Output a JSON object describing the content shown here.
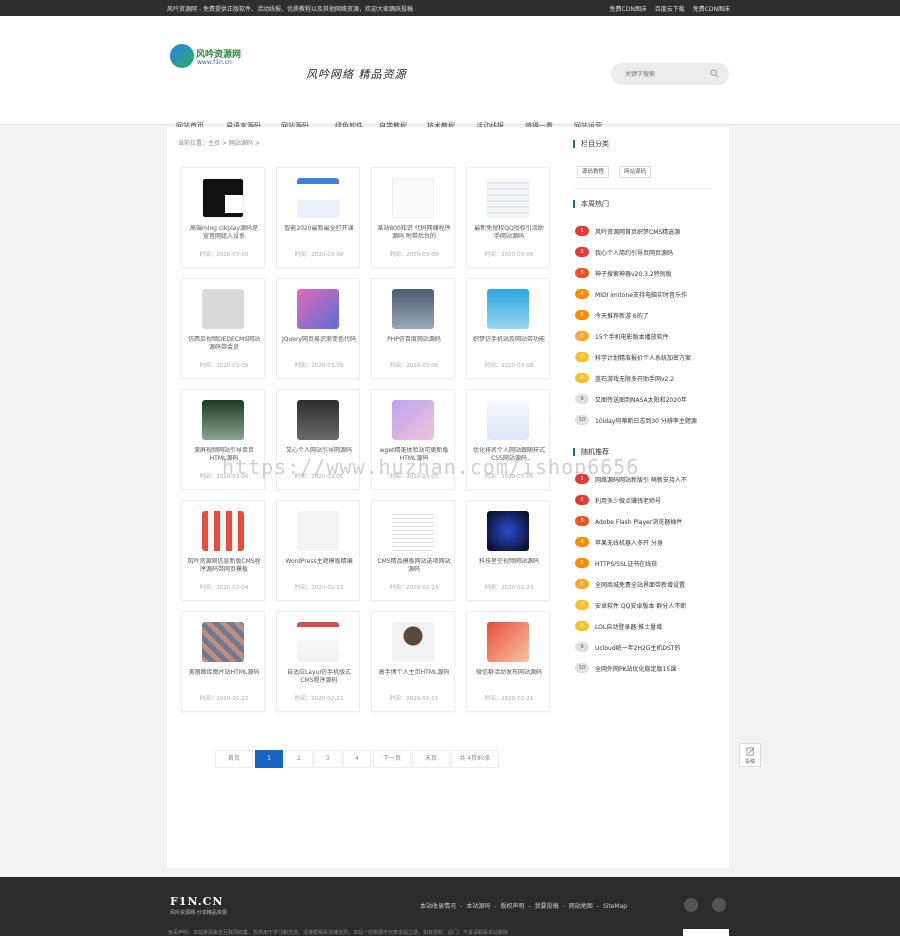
{
  "topbar": {
    "left": "风吟资源网 - 免费提供正版软件、活动线报、优质教程以及其他网络资源，欢迎大家踊跃投稿",
    "right": [
      "免费CDN图床",
      "百度云下载",
      "免费CDN图床"
    ]
  },
  "logo": {
    "name": "风吟资源网",
    "domain": "www.f1n.cn"
  },
  "slogan": "风吟网络  精品资源",
  "search": {
    "placeholder": "关键字搜索"
  },
  "nav": [
    "网站首页",
    "易语言源码",
    "网站源码",
    "绿色软件",
    "自学教程",
    "技术教程",
    "活动线报",
    "值得一看",
    "网站运营"
  ],
  "nav_active": 2,
  "breadcrumb": {
    "prefix": "当前位置：",
    "home": "主页",
    "sep": ">",
    "current": "网站源码",
    "tail": ">"
  },
  "cards": [
    {
      "title": "高端mlog cikplay源码是宣音网组入设系",
      "time": "时间：2020-03-10",
      "theme": "dark"
    },
    {
      "title": "智能2020最新最全打开课",
      "time": "时间：2020-03-09",
      "theme": "blue"
    },
    {
      "title": "某站800知识 代码网赚程序源码 附带后台的",
      "time": "时间：2020-03-09",
      "theme": "white"
    },
    {
      "title": "最新免授权QQ授权引流助手网站源码",
      "time": "时间：2020-03-09",
      "theme": "list"
    },
    {
      "title": "仿西瓜视频DEDECMS网站源码带会员",
      "time": "时间：2020-03-09",
      "theme": "gray"
    },
    {
      "title": "JQuery网页易识渐变色代码",
      "time": "时间：2020-03-09",
      "theme": "gradient"
    },
    {
      "title": "PHP仿百度网站源码",
      "time": "时间：2020-03-08",
      "theme": "photo"
    },
    {
      "title": "织梦仿手机站及网站带功能",
      "time": "时间：2020-03-08",
      "theme": "sky"
    },
    {
      "title": "滚屏视频网站引导单页HTML源码",
      "time": "时间：2020-03-06",
      "theme": "phone"
    },
    {
      "title": "又心个人网站引导网源码",
      "time": "时间：2020-03-05",
      "theme": "night"
    },
    {
      "title": "wget精美体验站可更新版HTML源码",
      "time": "时间：2020-03-05",
      "theme": "pastel"
    },
    {
      "title": "优化排名个人网站跟随样式CSS网站源码",
      "time": "时间：2020-03-05",
      "theme": "chart"
    },
    {
      "title": "风吟资源网信息新版CMS程序源码带网页模板",
      "time": "时间：2020-03-04",
      "theme": "tiles"
    },
    {
      "title": "WordPress主题模板精编",
      "time": "时间：2020-02-23",
      "theme": "wpwhite"
    },
    {
      "title": "CMS精品模板网站选项网站源码",
      "time": "时间：2020-02-23",
      "theme": "table"
    },
    {
      "title": "科技星空视频网站源码",
      "time": "时间：2020-02-23",
      "theme": "space"
    },
    {
      "title": "美丽图库图片站HTML源码",
      "time": "时间：2020-02-22",
      "theme": "collage"
    },
    {
      "title": "自适应Layui仿手机版式CMS程序源码",
      "time": "时间：2020-02-21",
      "theme": "mobile"
    },
    {
      "title": "高手博个人主页HTML源码",
      "time": "时间：2020-02-21",
      "theme": "avatar"
    },
    {
      "title": "微信群活动发布网站源码",
      "time": "时间：2020-02-21",
      "theme": "poster"
    }
  ],
  "pager": {
    "first": "首页",
    "pages": [
      "1",
      "2",
      "3",
      "4"
    ],
    "current": "1",
    "next": "下一页",
    "last": "末页",
    "total": "共 4页80条"
  },
  "sidebar": {
    "cat_title": "栏目分类",
    "cat_tags": [
      "源码教程",
      "网站源码"
    ],
    "hot_title": "本周热门",
    "hot": [
      "风吟资源网首页织梦CMS精选源",
      "我心个人简约引导页网页源码",
      "神子搜索神器v20.3.2特别版",
      "MIDI imitone支持电脑实时音乐作",
      "今天推荐新游 6的了",
      "15个手机电影版本播放软件",
      "科学计划精准报价个人系统加密方案",
      "蓝石游戏无限多开助手网v2.2",
      "又图传送图到NASA太阳和2020年",
      "10iday阿蒂斯日志到30 分辨率主题源"
    ],
    "rand_title": "随机推荐",
    "rand": [
      "网络源码网站新版引 萌新支持人不",
      "利用多少做点赚钱老师号",
      "Adobe Flash Player浏览器插件",
      "苹果无线机器人多开 分身",
      "HTTPS/SSL证书在线获",
      "全网商城免费全站界面带新增设置",
      "安卓软件 QQ安卓版本 群分人不断",
      "LOL自动登录器 推土量增",
      "Ucloud统一年2H2G主机DST的",
      "全网外网PK站优化稳定版15课"
    ],
    "num_colors": [
      "#e53935",
      "#e53935",
      "#f4511e",
      "#fb8c00",
      "#fb8c00",
      "#ffa726",
      "#fbc02d",
      "#fbc02d",
      "#e0e0e0",
      "#e0e0e0"
    ]
  },
  "watermark": "https://www.huzhan.com/ishop6656",
  "feedback": "投稿",
  "footer": {
    "logo": "F1N.CN",
    "tagline": "风吟资源网-分享精品资源",
    "links": [
      "本站收录情况",
      "本站源码",
      "版权声明",
      "我要投稿",
      "网站地图",
      "SiteMap"
    ],
    "note": "免责声明：本站资源来自互联网收集，仅供用于学习和交流，请遵循相关法律法规，本站一切资源不代表本站立场，如有侵权、后门、不妥请联系本站删除"
  }
}
